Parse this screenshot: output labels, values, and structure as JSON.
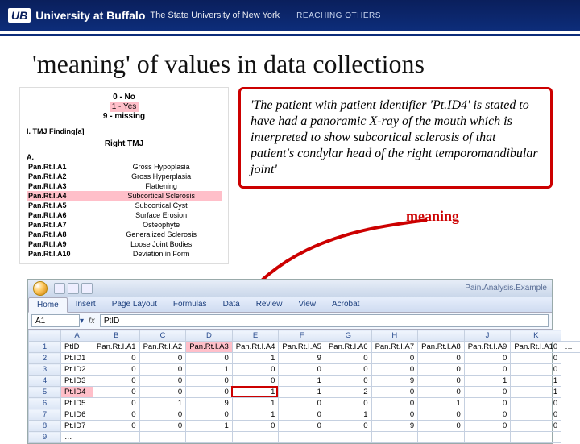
{
  "header": {
    "logo_mark": "UB",
    "university": "University at Buffalo",
    "suny": "The State University of New York",
    "reaching": "REACHING OTHERS"
  },
  "slide_title": "'meaning' of values in data collections",
  "left_panel": {
    "section": "I.  TMJ Finding[a]",
    "subhead": "Right TMJ",
    "aletter": "A.",
    "rows": [
      {
        "k": "Pan.Rt.I.A1",
        "v": "Gross Hypoplasia"
      },
      {
        "k": "Pan.Rt.I.A2",
        "v": "Gross Hyperplasia"
      },
      {
        "k": "Pan.Rt.I.A3",
        "v": "Flattening"
      },
      {
        "k": "Pan.Rt.I.A4",
        "v": "Subcortical Sclerosis",
        "hl": true
      },
      {
        "k": "Pan.Rt.I.A5",
        "v": "Subcortical Cyst"
      },
      {
        "k": "Pan.Rt.I.A6",
        "v": "Surface Erosion"
      },
      {
        "k": "Pan.Rt.I.A7",
        "v": "Osteophyte"
      },
      {
        "k": "Pan.Rt.I.A8",
        "v": "Generalized Sclerosis"
      },
      {
        "k": "Pan.Rt.I.A9",
        "v": "Loose Joint Bodies"
      },
      {
        "k": "Pan.Rt.I.A10",
        "v": "Deviation in Form"
      }
    ]
  },
  "legend": {
    "no": "0 - No",
    "yes": "1 - Yes",
    "miss": "9 - missing"
  },
  "callout": "'The patient with patient identifier 'Pt.ID4' is stated to have had a panoramic X-ray of the mouth which is interpreted to show subcortical sclerosis of that patient's condylar head of the right temporomandibular joint'",
  "meaning_label": "meaning",
  "excel": {
    "window_title": "Pain.Analysis.Example",
    "tabs": [
      "Home",
      "Insert",
      "Page Layout",
      "Formulas",
      "Data",
      "Review",
      "View",
      "Acrobat"
    ],
    "active_tab": "Home",
    "namebox": "A1",
    "formula": "PtID",
    "columns": [
      "",
      "A",
      "B",
      "C",
      "D",
      "E",
      "F",
      "G",
      "H",
      "I",
      "J",
      "K"
    ],
    "header_row": [
      "PtID",
      "Pan.Rt.I.A1",
      "Pan.Rt.I.A2",
      "Pan.Rt.I.A3",
      "Pan.Rt.I.A4",
      "Pan.Rt.I.A5",
      "Pan.Rt.I.A6",
      "Pan.Rt.I.A7",
      "Pan.Rt.I.A8",
      "Pan.Rt.I.A9",
      "Pan.Rt.I.A10",
      "…"
    ],
    "data_rows": [
      {
        "r": 2,
        "id": "Pt.ID1",
        "v": [
          0,
          0,
          0,
          1,
          9,
          0,
          0,
          0,
          0,
          0
        ]
      },
      {
        "r": 3,
        "id": "Pt.ID2",
        "v": [
          0,
          0,
          1,
          0,
          0,
          0,
          0,
          0,
          0,
          0
        ]
      },
      {
        "r": 4,
        "id": "Pt.ID3",
        "v": [
          0,
          0,
          0,
          0,
          1,
          0,
          9,
          0,
          1,
          1
        ]
      },
      {
        "r": 5,
        "id": "Pt.ID4",
        "v": [
          0,
          0,
          0,
          1,
          1,
          2,
          0,
          0,
          0,
          1
        ],
        "hl": true
      },
      {
        "r": 6,
        "id": "Pt.ID5",
        "v": [
          0,
          1,
          9,
          1,
          0,
          0,
          0,
          1,
          0,
          0
        ]
      },
      {
        "r": 7,
        "id": "Pt.ID6",
        "v": [
          0,
          0,
          0,
          1,
          0,
          1,
          0,
          0,
          0,
          0
        ]
      },
      {
        "r": 8,
        "id": "Pt.ID7",
        "v": [
          0,
          0,
          1,
          0,
          0,
          0,
          9,
          0,
          0,
          0
        ]
      },
      {
        "r": 9,
        "id": "…",
        "v": [
          "",
          "",
          "",
          "",
          "",
          "",
          "",
          "",
          "",
          ""
        ]
      }
    ]
  }
}
